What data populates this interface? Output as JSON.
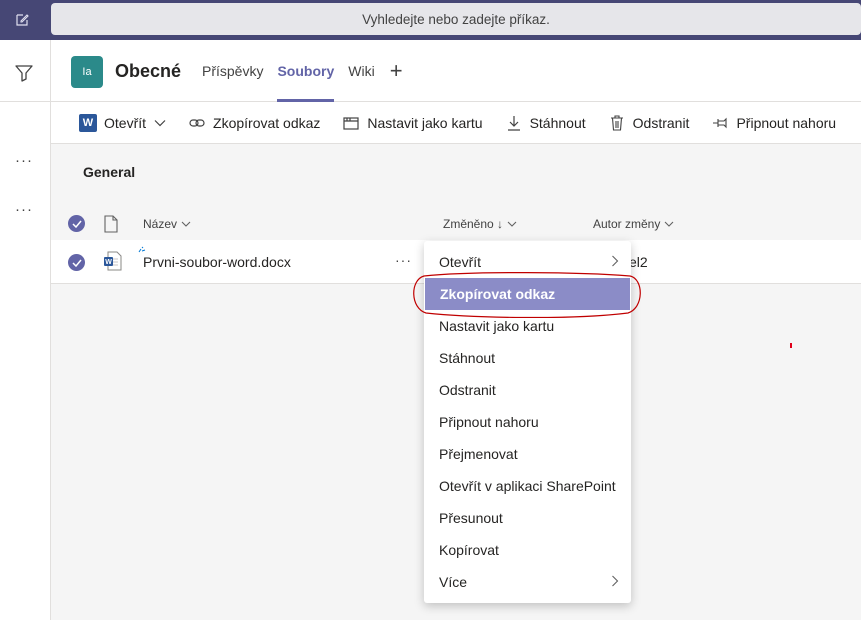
{
  "search": {
    "placeholder": "Vyhledejte nebo zadejte příkaz."
  },
  "left_rail": {
    "more_1": "···",
    "more_2": "···"
  },
  "channel": {
    "avatar_initials": "Ia",
    "name": "Obecné",
    "tabs": [
      {
        "label": "Příspěvky"
      },
      {
        "label": "Soubory"
      },
      {
        "label": "Wiki"
      }
    ],
    "add_tab": "+"
  },
  "toolbar": {
    "open": "Otevřít",
    "copy_link": "Zkopírovat odkaz",
    "make_tab": "Nastavit jako kartu",
    "download": "Stáhnout",
    "delete": "Odstranit",
    "pin": "Připnout nahoru"
  },
  "breadcrumb": "General",
  "columns": {
    "name": "Název",
    "modified": "Změněno ↓",
    "modified_by": "Autor změny"
  },
  "file": {
    "name": "Prvni-soubor-word.docx",
    "more": "···",
    "modified_by_partial": "el2"
  },
  "menu": {
    "items": [
      {
        "label": "Otevřít"
      },
      {
        "label": "Zkopírovat odkaz"
      },
      {
        "label": "Nastavit jako kartu"
      },
      {
        "label": "Stáhnout"
      },
      {
        "label": "Odstranit"
      },
      {
        "label": "Připnout nahoru"
      },
      {
        "label": "Přejmenovat"
      },
      {
        "label": "Otevřít v aplikaci SharePoint"
      },
      {
        "label": "Přesunout"
      },
      {
        "label": "Kopírovat"
      },
      {
        "label": "Více"
      }
    ]
  },
  "colors": {
    "brand": "#6264a7",
    "top_bar": "#464775",
    "highlight": "#8b8cc7",
    "annotation": "#c00000"
  }
}
